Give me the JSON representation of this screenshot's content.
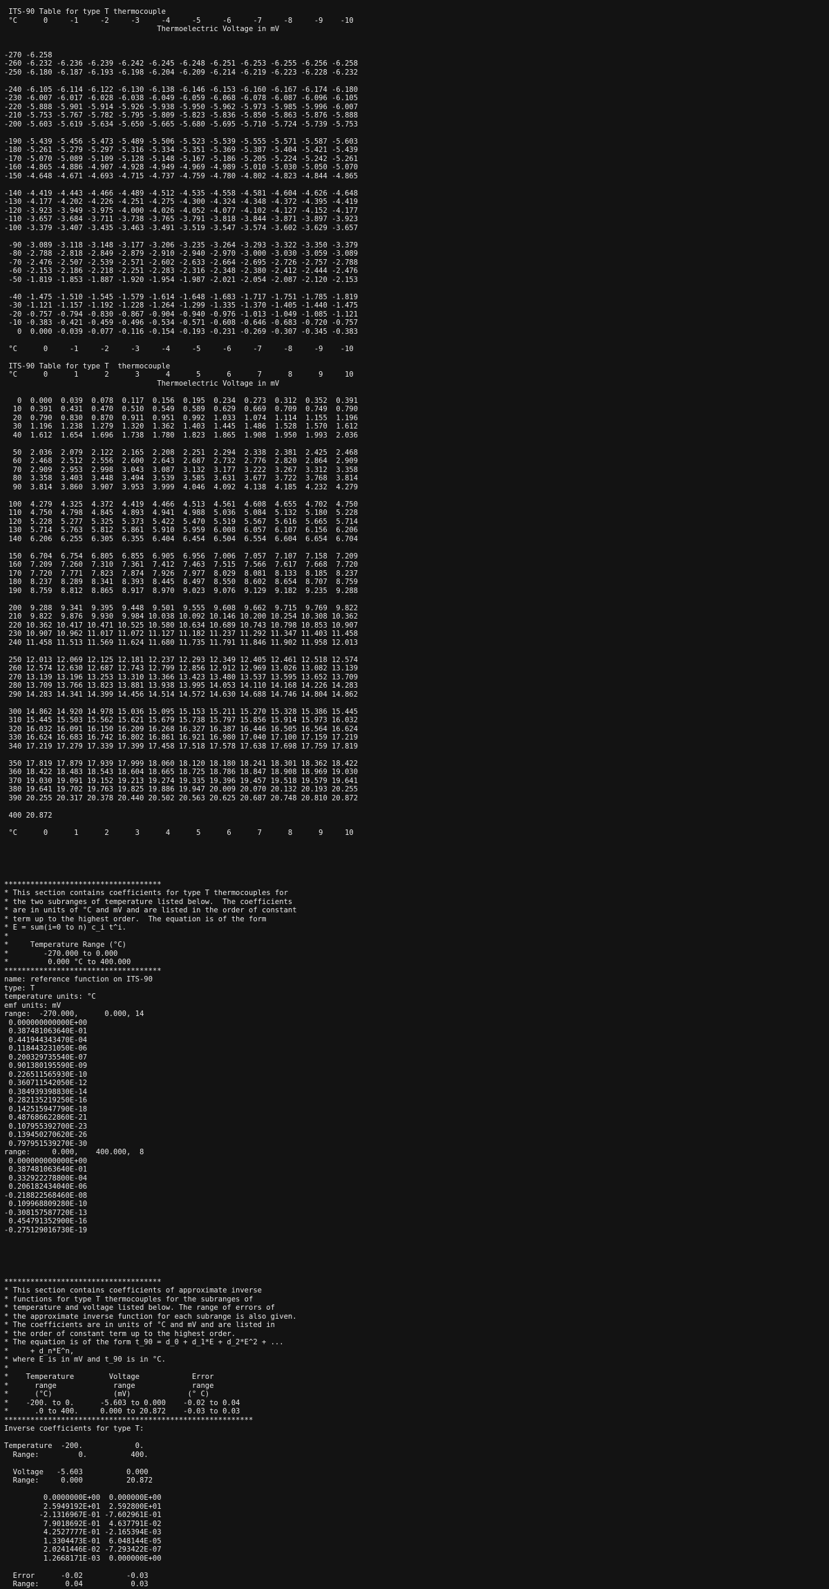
{
  "document": {
    "type": "text/plain",
    "lines": [
      " ITS-90 Table for type T thermocouple",
      " °C      0     -1     -2     -3     -4     -5     -6     -7     -8     -9    -10",
      "                                   Thermoelectric Voltage in mV",
      "",
      "",
      "-270 -6.258",
      "-260 -6.232 -6.236 -6.239 -6.242 -6.245 -6.248 -6.251 -6.253 -6.255 -6.256 -6.258",
      "-250 -6.180 -6.187 -6.193 -6.198 -6.204 -6.209 -6.214 -6.219 -6.223 -6.228 -6.232",
      "",
      "-240 -6.105 -6.114 -6.122 -6.130 -6.138 -6.146 -6.153 -6.160 -6.167 -6.174 -6.180",
      "-230 -6.007 -6.017 -6.028 -6.038 -6.049 -6.059 -6.068 -6.078 -6.087 -6.096 -6.105",
      "-220 -5.888 -5.901 -5.914 -5.926 -5.938 -5.950 -5.962 -5.973 -5.985 -5.996 -6.007",
      "-210 -5.753 -5.767 -5.782 -5.795 -5.809 -5.823 -5.836 -5.850 -5.863 -5.876 -5.888",
      "-200 -5.603 -5.619 -5.634 -5.650 -5.665 -5.680 -5.695 -5.710 -5.724 -5.739 -5.753",
      "",
      "-190 -5.439 -5.456 -5.473 -5.489 -5.506 -5.523 -5.539 -5.555 -5.571 -5.587 -5.603",
      "-180 -5.261 -5.279 -5.297 -5.316 -5.334 -5.351 -5.369 -5.387 -5.404 -5.421 -5.439",
      "-170 -5.070 -5.089 -5.109 -5.128 -5.148 -5.167 -5.186 -5.205 -5.224 -5.242 -5.261",
      "-160 -4.865 -4.886 -4.907 -4.928 -4.949 -4.969 -4.989 -5.010 -5.030 -5.050 -5.070",
      "-150 -4.648 -4.671 -4.693 -4.715 -4.737 -4.759 -4.780 -4.802 -4.823 -4.844 -4.865",
      "",
      "-140 -4.419 -4.443 -4.466 -4.489 -4.512 -4.535 -4.558 -4.581 -4.604 -4.626 -4.648",
      "-130 -4.177 -4.202 -4.226 -4.251 -4.275 -4.300 -4.324 -4.348 -4.372 -4.395 -4.419",
      "-120 -3.923 -3.949 -3.975 -4.000 -4.026 -4.052 -4.077 -4.102 -4.127 -4.152 -4.177",
      "-110 -3.657 -3.684 -3.711 -3.738 -3.765 -3.791 -3.818 -3.844 -3.871 -3.897 -3.923",
      "-100 -3.379 -3.407 -3.435 -3.463 -3.491 -3.519 -3.547 -3.574 -3.602 -3.629 -3.657",
      "",
      " -90 -3.089 -3.118 -3.148 -3.177 -3.206 -3.235 -3.264 -3.293 -3.322 -3.350 -3.379",
      " -80 -2.788 -2.818 -2.849 -2.879 -2.910 -2.940 -2.970 -3.000 -3.030 -3.059 -3.089",
      " -70 -2.476 -2.507 -2.539 -2.571 -2.602 -2.633 -2.664 -2.695 -2.726 -2.757 -2.788",
      " -60 -2.153 -2.186 -2.218 -2.251 -2.283 -2.316 -2.348 -2.380 -2.412 -2.444 -2.476",
      " -50 -1.819 -1.853 -1.887 -1.920 -1.954 -1.987 -2.021 -2.054 -2.087 -2.120 -2.153",
      "",
      " -40 -1.475 -1.510 -1.545 -1.579 -1.614 -1.648 -1.683 -1.717 -1.751 -1.785 -1.819",
      " -30 -1.121 -1.157 -1.192 -1.228 -1.264 -1.299 -1.335 -1.370 -1.405 -1.440 -1.475",
      " -20 -0.757 -0.794 -0.830 -0.867 -0.904 -0.940 -0.976 -1.013 -1.049 -1.085 -1.121",
      " -10 -0.383 -0.421 -0.459 -0.496 -0.534 -0.571 -0.608 -0.646 -0.683 -0.720 -0.757",
      "   0  0.000 -0.039 -0.077 -0.116 -0.154 -0.193 -0.231 -0.269 -0.307 -0.345 -0.383",
      "",
      " °C      0     -1     -2     -3     -4     -5     -6     -7     -8     -9    -10",
      "",
      " ITS-90 Table for type T  thermocouple",
      " °C      0      1      2      3      4      5      6      7      8      9     10",
      "                                   Thermoelectric Voltage in mV",
      "",
      "   0  0.000  0.039  0.078  0.117  0.156  0.195  0.234  0.273  0.312  0.352  0.391",
      "  10  0.391  0.431  0.470  0.510  0.549  0.589  0.629  0.669  0.709  0.749  0.790",
      "  20  0.790  0.830  0.870  0.911  0.951  0.992  1.033  1.074  1.114  1.155  1.196",
      "  30  1.196  1.238  1.279  1.320  1.362  1.403  1.445  1.486  1.528  1.570  1.612",
      "  40  1.612  1.654  1.696  1.738  1.780  1.823  1.865  1.908  1.950  1.993  2.036",
      "",
      "  50  2.036  2.079  2.122  2.165  2.208  2.251  2.294  2.338  2.381  2.425  2.468",
      "  60  2.468  2.512  2.556  2.600  2.643  2.687  2.732  2.776  2.820  2.864  2.909",
      "  70  2.909  2.953  2.998  3.043  3.087  3.132  3.177  3.222  3.267  3.312  3.358",
      "  80  3.358  3.403  3.448  3.494  3.539  3.585  3.631  3.677  3.722  3.768  3.814",
      "  90  3.814  3.860  3.907  3.953  3.999  4.046  4.092  4.138  4.185  4.232  4.279",
      "",
      " 100  4.279  4.325  4.372  4.419  4.466  4.513  4.561  4.608  4.655  4.702  4.750",
      " 110  4.750  4.798  4.845  4.893  4.941  4.988  5.036  5.084  5.132  5.180  5.228",
      " 120  5.228  5.277  5.325  5.373  5.422  5.470  5.519  5.567  5.616  5.665  5.714",
      " 130  5.714  5.763  5.812  5.861  5.910  5.959  6.008  6.057  6.107  6.156  6.206",
      " 140  6.206  6.255  6.305  6.355  6.404  6.454  6.504  6.554  6.604  6.654  6.704",
      "",
      " 150  6.704  6.754  6.805  6.855  6.905  6.956  7.006  7.057  7.107  7.158  7.209",
      " 160  7.209  7.260  7.310  7.361  7.412  7.463  7.515  7.566  7.617  7.668  7.720",
      " 170  7.720  7.771  7.823  7.874  7.926  7.977  8.029  8.081  8.133  8.185  8.237",
      " 180  8.237  8.289  8.341  8.393  8.445  8.497  8.550  8.602  8.654  8.707  8.759",
      " 190  8.759  8.812  8.865  8.917  8.970  9.023  9.076  9.129  9.182  9.235  9.288",
      "",
      " 200  9.288  9.341  9.395  9.448  9.501  9.555  9.608  9.662  9.715  9.769  9.822",
      " 210  9.822  9.876  9.930  9.984 10.038 10.092 10.146 10.200 10.254 10.308 10.362",
      " 220 10.362 10.417 10.471 10.525 10.580 10.634 10.689 10.743 10.798 10.853 10.907",
      " 230 10.907 10.962 11.017 11.072 11.127 11.182 11.237 11.292 11.347 11.403 11.458",
      " 240 11.458 11.513 11.569 11.624 11.680 11.735 11.791 11.846 11.902 11.958 12.013",
      "",
      " 250 12.013 12.069 12.125 12.181 12.237 12.293 12.349 12.405 12.461 12.518 12.574",
      " 260 12.574 12.630 12.687 12.743 12.799 12.856 12.912 12.969 13.026 13.082 13.139",
      " 270 13.139 13.196 13.253 13.310 13.366 13.423 13.480 13.537 13.595 13.652 13.709",
      " 280 13.709 13.766 13.823 13.881 13.938 13.995 14.053 14.110 14.168 14.226 14.283",
      " 290 14.283 14.341 14.399 14.456 14.514 14.572 14.630 14.688 14.746 14.804 14.862",
      "",
      " 300 14.862 14.920 14.978 15.036 15.095 15.153 15.211 15.270 15.328 15.386 15.445",
      " 310 15.445 15.503 15.562 15.621 15.679 15.738 15.797 15.856 15.914 15.973 16.032",
      " 320 16.032 16.091 16.150 16.209 16.268 16.327 16.387 16.446 16.505 16.564 16.624",
      " 330 16.624 16.683 16.742 16.802 16.861 16.921 16.980 17.040 17.100 17.159 17.219",
      " 340 17.219 17.279 17.339 17.399 17.458 17.518 17.578 17.638 17.698 17.759 17.819",
      "",
      " 350 17.819 17.879 17.939 17.999 18.060 18.120 18.180 18.241 18.301 18.362 18.422",
      " 360 18.422 18.483 18.543 18.604 18.665 18.725 18.786 18.847 18.908 18.969 19.030",
      " 370 19.030 19.091 19.152 19.213 19.274 19.335 19.396 19.457 19.518 19.579 19.641",
      " 380 19.641 19.702 19.763 19.825 19.886 19.947 20.009 20.070 20.132 20.193 20.255",
      " 390 20.255 20.317 20.378 20.440 20.502 20.563 20.625 20.687 20.748 20.810 20.872",
      "",
      " 400 20.872",
      "",
      " °C      0      1      2      3      4      5      6      7      8      9     10",
      "",
      "",
      "",
      "",
      "",
      "************************************",
      "* This section contains coefficients for type T thermocouples for",
      "* the two subranges of temperature listed below.  The coefficients",
      "* are in units of °C and mV and are listed in the order of constant",
      "* term up to the highest order.  The equation is of the form",
      "* E = sum(i=0 to n) c_i t^i.",
      "*",
      "*     Temperature Range (°C)",
      "*        -270.000 to 0.000",
      "*         0.000 °C to 400.000",
      "************************************",
      "name: reference function on ITS-90",
      "type: T",
      "temperature units: °C",
      "emf units: mV",
      "range:  -270.000,      0.000, 14",
      " 0.000000000000E+00",
      " 0.387481063640E-01",
      " 0.441944343470E-04",
      " 0.118443231050E-06",
      " 0.200329735540E-07",
      " 0.901380195590E-09",
      " 0.226511565930E-10",
      " 0.360711542050E-12",
      " 0.384939398830E-14",
      " 0.282135219250E-16",
      " 0.142515947790E-18",
      " 0.487686622860E-21",
      " 0.107955392700E-23",
      " 0.139450270620E-26",
      " 0.797951539270E-30",
      "range:     0.000,    400.000,  8",
      " 0.000000000000E+00",
      " 0.387481063640E-01",
      " 0.332922278800E-04",
      " 0.206182434040E-06",
      "-0.218822568460E-08",
      " 0.109968809280E-10",
      "-0.308157587720E-13",
      " 0.454791352900E-16",
      "-0.275129016730E-19",
      "",
      "",
      "",
      "",
      "",
      "************************************",
      "* This section contains coefficients of approximate inverse",
      "* functions for type T thermocouples for the subranges of",
      "* temperature and voltage listed below. The range of errors of",
      "* the approximate inverse function for each subrange is also given.",
      "* The coefficients are in units of °C and mV and are listed in",
      "* the order of constant term up to the highest order.",
      "* The equation is of the form t_90 = d_0 + d_1*E + d_2*E^2 + ...",
      "*     + d_n*E^n,",
      "* where E is in mV and t_90 is in °C.",
      "*",
      "*    Temperature        Voltage            Error",
      "*      range             range             range",
      "*      (°C)              (mV)             (° C)",
      "*    -200. to 0.      -5.603 to 0.000    -0.02 to 0.04",
      "*      .0 to 400.     0.000 to 20.872    -0.03 to 0.03",
      "*********************************************************",
      "Inverse coefficients for type T:",
      "",
      "Temperature  -200.            0.",
      "  Range:         0.          400.",
      "",
      "  Voltage   -5.603          0.000",
      "  Range:     0.000          20.872",
      "",
      "         0.0000000E+00  0.000000E+00",
      "         2.5949192E+01  2.592800E+01",
      "        -2.1316967E-01 -7.602961E-01",
      "         7.9018692E-01  4.637791E-02",
      "         4.2527777E-01 -2.165394E-03",
      "         1.3304473E-01  6.048144E-05",
      "         2.0241446E-02 -7.293422E-07",
      "         1.2668171E-03  0.000000E+00",
      "",
      "  Error      -0.02          -0.03",
      "  Range:      0.04           0.03"
    ]
  }
}
